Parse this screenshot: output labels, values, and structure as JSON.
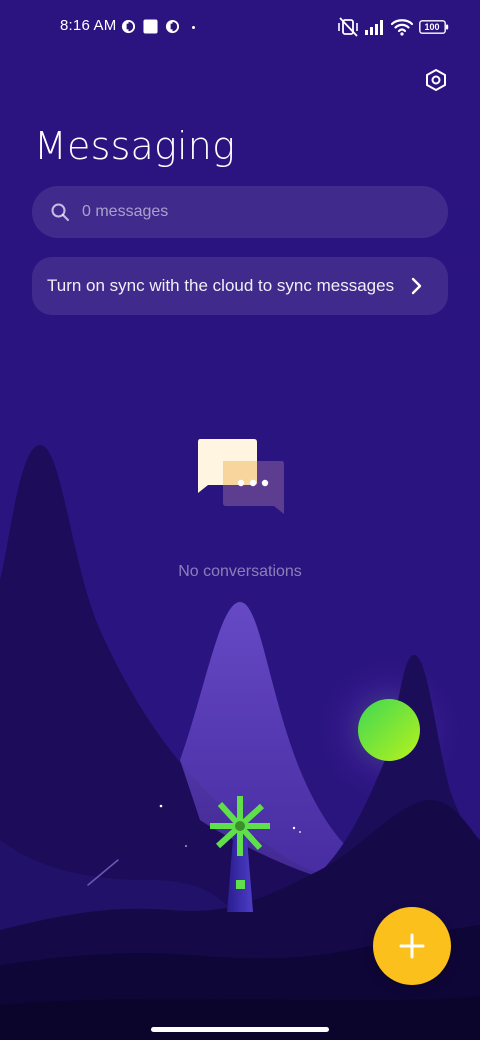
{
  "status_bar": {
    "time": "8:16 AM",
    "battery": "100"
  },
  "header": {
    "title": "Messaging",
    "settings_icon": "settings-hexagon-icon"
  },
  "search": {
    "placeholder": "0 messages",
    "value": ""
  },
  "sync_banner": {
    "text": "Turn on sync with the cloud to sync messages",
    "icon": "chevron-right-icon"
  },
  "empty_state": {
    "message": "No conversations",
    "icon": "chat-bubbles-icon"
  },
  "fab": {
    "icon": "plus-icon"
  },
  "colors": {
    "background": "#2a1478",
    "fab": "#fbc01b",
    "moon": "#7be831",
    "windmill": "#5fe04a"
  }
}
